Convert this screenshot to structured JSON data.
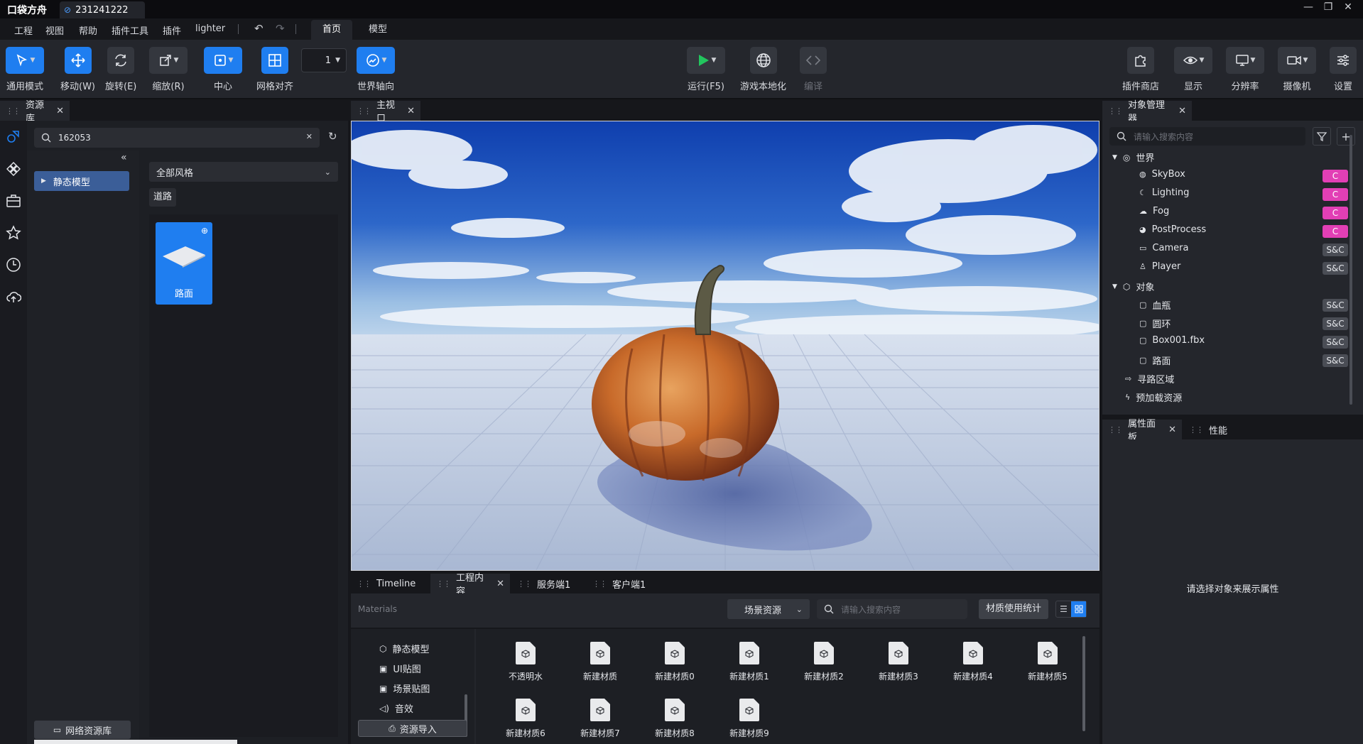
{
  "app": {
    "logo": "口袋方舟",
    "project_tab": "231241222",
    "window_controls": [
      "—",
      "❐",
      "✕"
    ]
  },
  "menu": {
    "items": [
      "工程",
      "视图",
      "帮助",
      "插件工具",
      "插件",
      "lighter"
    ],
    "ribbon_tabs": [
      "首页",
      "模型"
    ],
    "active_tab": "首页"
  },
  "toolbar": {
    "general_mode": "通用模式",
    "move": "移动(W)",
    "rotate": "旋转(E)",
    "scale": "缩放(R)",
    "center": "中心",
    "grid_snap": "网格对齐",
    "grid_value": "1",
    "world_axis": "世界轴向",
    "run": "运行(F5)",
    "localize": "游戏本地化",
    "compile": "编译",
    "plugin_store": "插件商店",
    "display": "显示",
    "resolution": "分辨率",
    "camera": "摄像机",
    "settings": "设置"
  },
  "asset_library": {
    "tab": "资源库",
    "search_value": "162053",
    "category": "静态模型",
    "style_select": "全部风格",
    "filter_chip": "道路",
    "asset_card": "路面",
    "network_button": "网络资源库"
  },
  "viewport": {
    "tab": "主视口"
  },
  "bottom_panel": {
    "tabs": [
      "Timeline",
      "工程内容",
      "服务端1",
      "客户端1"
    ],
    "active_tab": "工程内容",
    "path": "Materials",
    "scene_select": "场景资源",
    "search_placeholder": "请输入搜索内容",
    "stats_button": "材质使用统计",
    "folders": [
      "静态模型",
      "UI贴图",
      "场景贴图",
      "音效"
    ],
    "import_button": "资源导入",
    "materials": [
      "不透明水",
      "新建材质",
      "新建材质0",
      "新建材质1",
      "新建材质2",
      "新建材质3",
      "新建材质4",
      "新建材质5",
      "新建材质6",
      "新建材质7",
      "新建材质8",
      "新建材质9"
    ]
  },
  "object_manager": {
    "tab": "对象管理器",
    "search_placeholder": "请输入搜索内容",
    "world_label": "世界",
    "world_children": [
      {
        "name": "SkyBox",
        "badge": "C"
      },
      {
        "name": "Lighting",
        "badge": "C"
      },
      {
        "name": "Fog",
        "badge": "C"
      },
      {
        "name": "PostProcess",
        "badge": "C"
      },
      {
        "name": "Camera",
        "badge": "S&C"
      },
      {
        "name": "Player",
        "badge": "S&C"
      }
    ],
    "objects_label": "对象",
    "objects_children": [
      {
        "name": "血瓶",
        "badge": "S&C"
      },
      {
        "name": "圆环",
        "badge": "S&C"
      },
      {
        "name": "Box001.fbx",
        "badge": "S&C"
      },
      {
        "name": "路面",
        "badge": "S&C"
      }
    ],
    "nav_area": "寻路区域",
    "preload": "预加载资源"
  },
  "properties": {
    "tabs": [
      "属性面板",
      "性能"
    ],
    "empty_message": "请选择对象来展示属性"
  },
  "colors": {
    "accent": "#1f7ef0",
    "client_badge": "#e23fb5",
    "run_green": "#22c55e"
  }
}
